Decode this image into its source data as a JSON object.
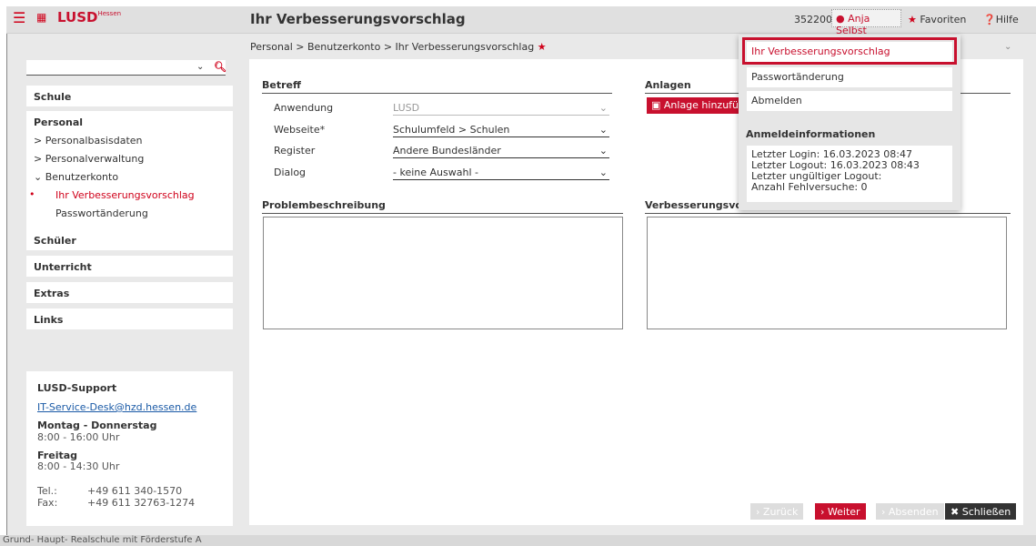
{
  "header": {
    "menu_icon": "hamburger-icon",
    "app_name": "LUSD",
    "app_sup": "Hessen",
    "page_title": "Ihr Verbesserungsvorschlag",
    "user_number": "352200",
    "user_name": "Anja Selbst",
    "favorites": "Favoriten",
    "help": "Hilfe"
  },
  "breadcrumb": "Personal > Benutzerkonto > Ihr Verbesserungsvorschlag",
  "sidebar": {
    "search_value": "",
    "items": [
      {
        "label": "Schule"
      },
      {
        "label": "Personal"
      },
      {
        "label": "Schüler"
      },
      {
        "label": "Unterricht"
      },
      {
        "label": "Extras"
      },
      {
        "label": "Links"
      }
    ],
    "personal_sub": [
      "> Personalbasisdaten",
      "> Personalverwaltung",
      "Benutzerkonto",
      "Ihr Verbesserungsvorschlag",
      "Passwortänderung"
    ]
  },
  "support": {
    "title": "LUSD-Support",
    "email": "IT-Service-Desk@hzd.hessen.de",
    "days1": "Montag - Donnerstag",
    "hours1": "8:00 - 16:00 Uhr",
    "days2": "Freitag",
    "hours2": "8:00 - 14:30 Uhr",
    "tel_label": "Tel.:",
    "tel": "+49 611 340-1570",
    "fax_label": "Fax:",
    "fax": "+49 611 32763-1274"
  },
  "form": {
    "betreff": "Betreff",
    "anlagen": "Anlagen",
    "anlage_btn": "Anlage hinzufügen",
    "fields": [
      {
        "label": "Anwendung",
        "value": "LUSD"
      },
      {
        "label": "Webseite*",
        "value": "Schulumfeld > Schulen"
      },
      {
        "label": "Register",
        "value": "Andere Bundesländer"
      },
      {
        "label": "Dialog",
        "value": "- keine Auswahl -"
      }
    ],
    "problem": "Problembeschreibung",
    "verbesserung": "Verbesserungsvorschlag"
  },
  "buttons": {
    "back": "Zurück",
    "next": "Weiter",
    "send": "Absenden",
    "close": "Schließen"
  },
  "dropdown": {
    "items": [
      "Ihr Verbesserungsvorschlag",
      "Passwortänderung",
      "Abmelden"
    ],
    "login_title": "Anmeldeinformationen",
    "last_login": "Letzter Login: 16.03.2023 08:47",
    "last_logout": "Letzter Logout: 16.03.2023 08:43",
    "invalid_logout": "Letzter ungültiger Logout:",
    "failed": "Anzahl Fehlversuche: 0"
  },
  "footer": "Grund- Haupt- Realschule mit Förderstufe A"
}
